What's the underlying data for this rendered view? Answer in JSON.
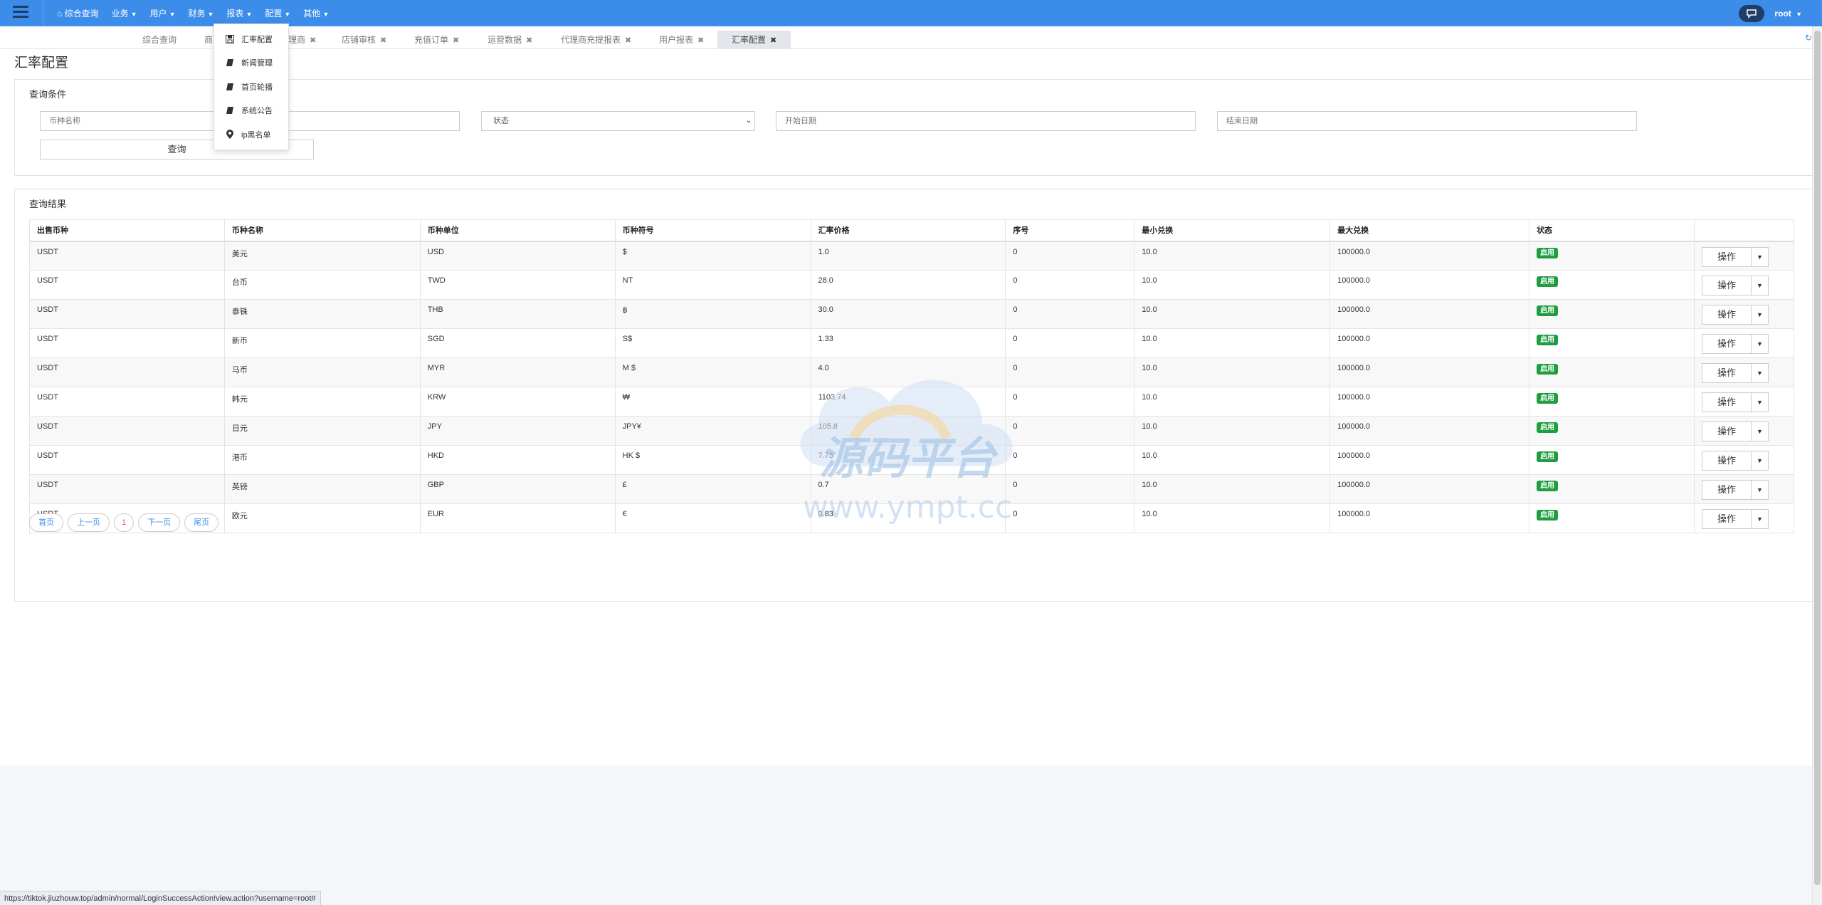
{
  "navbar": {
    "menu": [
      {
        "label": "综合查询",
        "icon": "home-icon",
        "has_caret": false
      },
      {
        "label": "业务",
        "has_caret": true
      },
      {
        "label": "用户",
        "has_caret": true
      },
      {
        "label": "财务",
        "has_caret": true
      },
      {
        "label": "报表",
        "has_caret": true
      },
      {
        "label": "配置",
        "has_caret": true
      },
      {
        "label": "其他",
        "has_caret": true
      }
    ],
    "user": "root",
    "accent_color": "#3c8dea"
  },
  "dropdown": {
    "items": [
      {
        "label": "汇率配置",
        "icon": "save-icon"
      },
      {
        "label": "新闻管理",
        "icon": "book-icon"
      },
      {
        "label": "首页轮播",
        "icon": "book-icon"
      },
      {
        "label": "系统公告",
        "icon": "book-icon"
      },
      {
        "label": "ip黑名单",
        "icon": "map-marker-icon"
      }
    ]
  },
  "tabs": [
    {
      "label": "综合查询",
      "closable": false
    },
    {
      "label": "商",
      "closable": false
    },
    {
      "label": "理商",
      "closable": true
    },
    {
      "label": "店铺审核",
      "closable": true
    },
    {
      "label": "充值订单",
      "closable": true
    },
    {
      "label": "运营数据",
      "closable": true
    },
    {
      "label": "代理商充提报表",
      "closable": true
    },
    {
      "label": "用户报表",
      "closable": true
    },
    {
      "label": "汇率配置",
      "closable": true,
      "active": true
    }
  ],
  "close_glyph": "✖",
  "page_title": "汇率配置",
  "query": {
    "title": "查询条件",
    "currency_name_placeholder": "币种名称",
    "status_value": "状态",
    "start_date_placeholder": "开始日期",
    "end_date_placeholder": "结束日期",
    "submit_label": "查询"
  },
  "results": {
    "title": "查询结果",
    "columns": [
      "出售币种",
      "币种名称",
      "币种单位",
      "币种符号",
      "汇率价格",
      "序号",
      "最小兑换",
      "最大兑换",
      "状态",
      ""
    ],
    "rows": [
      {
        "sell": "USDT",
        "name": "美元",
        "unit": "USD",
        "symbol": "$",
        "rate": "1.0",
        "seq": "0",
        "min": "10.0",
        "max": "100000.0",
        "status": "启用"
      },
      {
        "sell": "USDT",
        "name": "台币",
        "unit": "TWD",
        "symbol": "NT",
        "rate": "28.0",
        "seq": "0",
        "min": "10.0",
        "max": "100000.0",
        "status": "启用"
      },
      {
        "sell": "USDT",
        "name": "泰铢",
        "unit": "THB",
        "symbol": "฿",
        "rate": "30.0",
        "seq": "0",
        "min": "10.0",
        "max": "100000.0",
        "status": "启用"
      },
      {
        "sell": "USDT",
        "name": "新币",
        "unit": "SGD",
        "symbol": "S$",
        "rate": "1.33",
        "seq": "0",
        "min": "10.0",
        "max": "100000.0",
        "status": "启用"
      },
      {
        "sell": "USDT",
        "name": "马币",
        "unit": "MYR",
        "symbol": "M $",
        "rate": "4.0",
        "seq": "0",
        "min": "10.0",
        "max": "100000.0",
        "status": "启用"
      },
      {
        "sell": "USDT",
        "name": "韩元",
        "unit": "KRW",
        "symbol": "₩",
        "rate": "1103.74",
        "seq": "0",
        "min": "10.0",
        "max": "100000.0",
        "status": "启用"
      },
      {
        "sell": "USDT",
        "name": "日元",
        "unit": "JPY",
        "symbol": "JPY¥",
        "rate": "105.8",
        "seq": "0",
        "min": "10.0",
        "max": "100000.0",
        "status": "启用"
      },
      {
        "sell": "USDT",
        "name": "港币",
        "unit": "HKD",
        "symbol": "HK $",
        "rate": "7.75",
        "seq": "0",
        "min": "10.0",
        "max": "100000.0",
        "status": "启用"
      },
      {
        "sell": "USDT",
        "name": "英镑",
        "unit": "GBP",
        "symbol": "£",
        "rate": "0.7",
        "seq": "0",
        "min": "10.0",
        "max": "100000.0",
        "status": "启用"
      },
      {
        "sell": "USDT",
        "name": "欧元",
        "unit": "EUR",
        "symbol": "€",
        "rate": "0.83",
        "seq": "0",
        "min": "10.0",
        "max": "100000.0",
        "status": "启用"
      }
    ],
    "action_label": "操作",
    "status_color": "#1e9e41"
  },
  "pager": {
    "first": "首页",
    "prev": "上一页",
    "current": "1",
    "next": "下一页",
    "last": "尾页"
  },
  "watermark": {
    "text_main": "源码平台",
    "text_url": "www.ympt.cc"
  },
  "statusbar_url": "https://tiktok.jiuzhouw.top/admin/normal/LoginSuccessAction!view.action?username=root#"
}
